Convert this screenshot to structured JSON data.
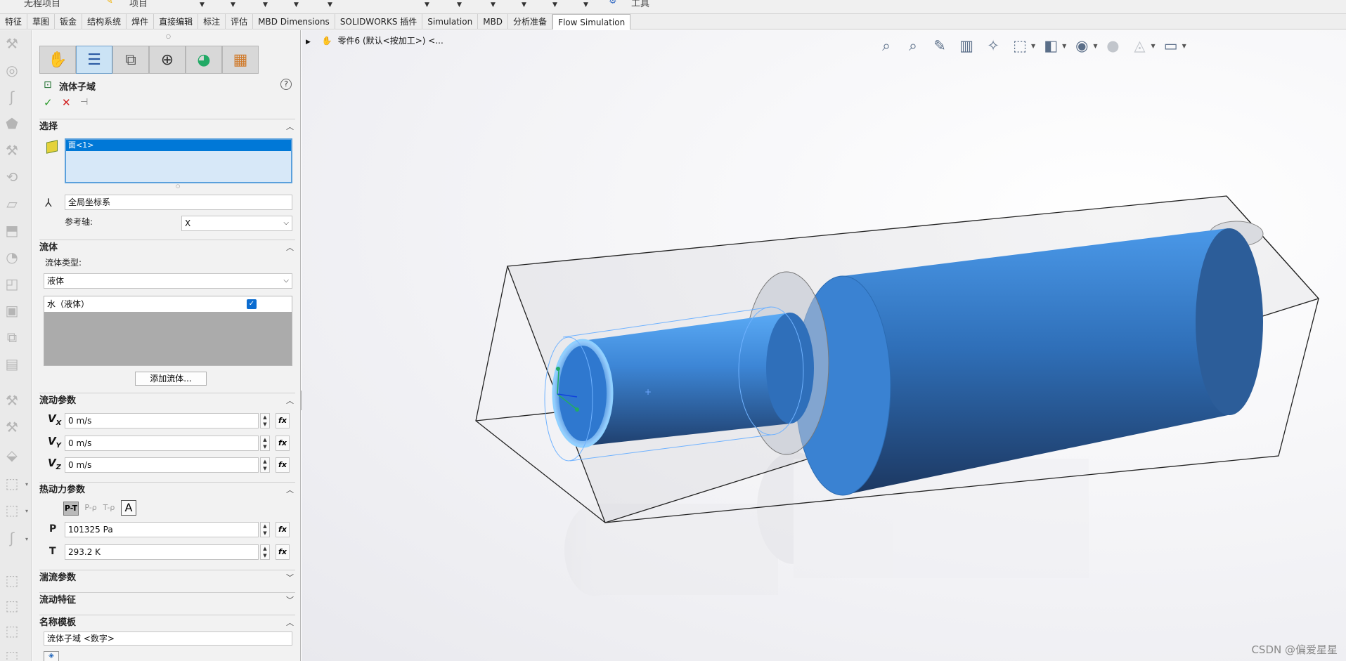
{
  "top_strip": {
    "left_fragment": "无程项目",
    "mid_fragment": "项目",
    "right_fragment": "工具"
  },
  "tabs": [
    {
      "label": "特征",
      "active": false
    },
    {
      "label": "草图",
      "active": false
    },
    {
      "label": "钣金",
      "active": false
    },
    {
      "label": "结构系统",
      "active": false
    },
    {
      "label": "焊件",
      "active": false
    },
    {
      "label": "直接编辑",
      "active": false
    },
    {
      "label": "标注",
      "active": false
    },
    {
      "label": "评估",
      "active": false
    },
    {
      "label": "MBD Dimensions",
      "active": false
    },
    {
      "label": "SOLIDWORKS 插件",
      "active": false
    },
    {
      "label": "Simulation",
      "active": false
    },
    {
      "label": "MBD",
      "active": false
    },
    {
      "label": "分析准备",
      "active": false
    },
    {
      "label": "Flow Simulation",
      "active": true
    }
  ],
  "pm": {
    "title": "流体子域",
    "help": "?",
    "ok": "✓",
    "cancel": "✕",
    "pin": "⊣",
    "selection": {
      "header": "选择",
      "item": "面<1>",
      "coord_system": "全局坐标系",
      "ref_axis_label": "参考轴:",
      "ref_axis_value": "X"
    },
    "fluids": {
      "header": "流体",
      "type_label": "流体类型:",
      "type_value": "液体",
      "list_item": "水（液体）",
      "add_button": "添加流体..."
    },
    "flow_params": {
      "header": "流动参数",
      "rows": [
        {
          "axis": "X",
          "value": "0 m/s"
        },
        {
          "axis": "Y",
          "value": "0 m/s"
        },
        {
          "axis": "Z",
          "value": "0 m/s"
        }
      ]
    },
    "thermo": {
      "header": "热动力参数",
      "modes": [
        "P-T",
        "P-ρ",
        "T-ρ"
      ],
      "mode_extra": "A",
      "p_label": "P",
      "p_value": "101325 Pa",
      "t_label": "T",
      "t_value": "293.2 K"
    },
    "turbulence": {
      "header": "湍流参数"
    },
    "flow_features": {
      "header": "流动特征"
    },
    "name_template": {
      "header": "名称模板",
      "value": "流体子域 <数字>"
    }
  },
  "viewport": {
    "tree_crumb": "零件6 (默认<按加工>) <...",
    "watermark": "CSDN @偏爱星星"
  },
  "colors": {
    "selection_blue": "#0078d7",
    "model_blue": "#3d86d6",
    "panel_bg": "#f2f2f2"
  }
}
